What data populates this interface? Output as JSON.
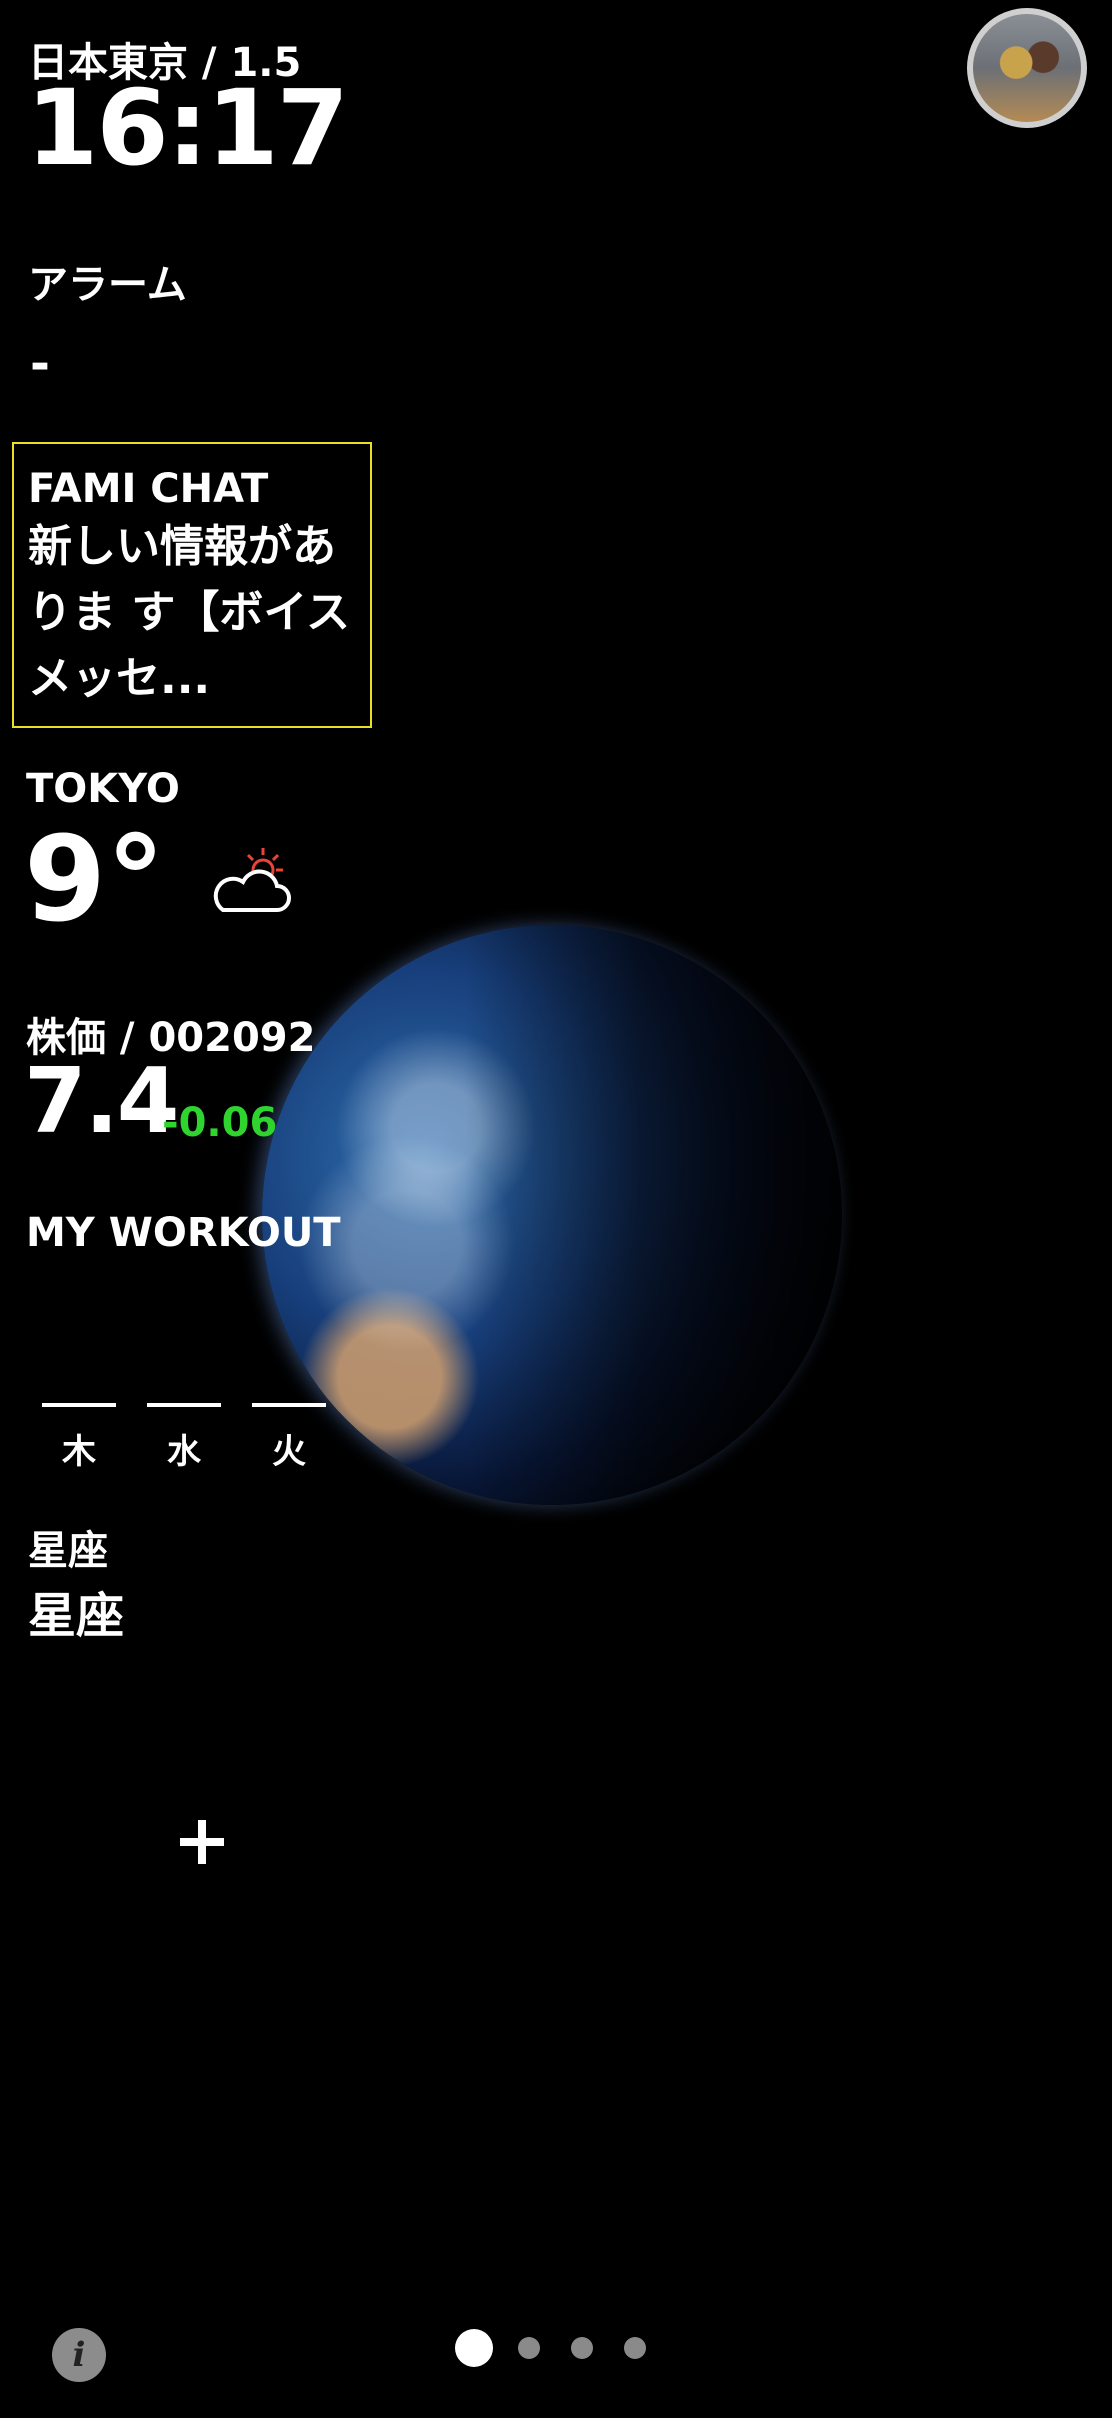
{
  "clock": {
    "label": "日本東京 / 1.5",
    "time": "16:17"
  },
  "alarm": {
    "label": "アラーム",
    "value": "-"
  },
  "chat": {
    "title": "FAMI CHAT",
    "text": "新しい情報がありま す【ボイスメッセ..."
  },
  "weather": {
    "city": "TOKYO",
    "temp": "9°",
    "icon": "partly-cloudy-sun-icon",
    "sun_color": "#e8443a"
  },
  "stock": {
    "label": "株価 / 002092",
    "price": "7.4",
    "change": "-0.06",
    "change_color": "#2fd42f"
  },
  "workout": {
    "label": "MY WORKOUT",
    "days": [
      "木",
      "水",
      "火"
    ]
  },
  "sign": {
    "title": "星座",
    "value": "星座"
  },
  "add": {
    "icon": "plus-icon"
  },
  "info": {
    "icon": "info-icon",
    "glyph": "i"
  },
  "pager": {
    "count": 4,
    "active": 0
  },
  "accent": {
    "chat_border": "#e8df2a"
  }
}
